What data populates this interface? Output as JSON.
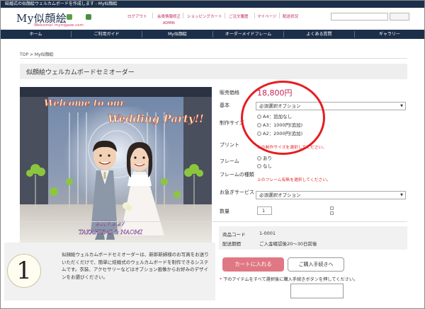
{
  "topbar": {
    "text": "結婚式の似顔絵ウェルカムボードを作成します - My似顔絵"
  },
  "header": {
    "logo_title": "My似顔絵",
    "logo_sub": "Welcome! mynigaoe.com",
    "nav": [
      "ログアウト",
      "会員情報修正",
      "ショッピングカート",
      "ご注文履歴",
      "マイページ",
      "配送状況"
    ],
    "nav_sub": "ADMIN",
    "search": {
      "value": "",
      "placeholder": ""
    }
  },
  "main_nav": [
    "ホーム",
    "ご利用ガイド",
    "My似顔絵",
    "オーダーメイドフレーム",
    "よくある質問",
    "ギャラリー"
  ],
  "breadcrumb": {
    "home": "TOP",
    "sep": ">",
    "current": "My似顔絵"
  },
  "page": {
    "title": "似顔絵ウェルカムボードセミオーダー"
  },
  "photo": {
    "line1": "Welcome to our",
    "line2": "Wedding Party!!",
    "date": "2017.2.27",
    "names": "TAKAHUMI & NAOMI"
  },
  "description": {
    "number": "1",
    "text": "似顔絵ウェルカムボードセミオーダーは、新郎新婦様のお写真をお送りいただくだけで、簡単に結婚式のウェルカムボードを制作できるシステムです。衣装、アクセサリーなどはオプション画像からお好みのデザインをお選びください。"
  },
  "options": {
    "price_label": "販売価格",
    "price": "18,800円",
    "basic_label": "基本",
    "basic_select": "必須選択オプション",
    "size_label": "制作サイズ",
    "sizes": [
      "A4：追加なし",
      "A3：1000円(追加)",
      "A2：2000円(追加)"
    ],
    "size_warning": "上の制作サイズを選択してください。",
    "print_label": "プリント",
    "frame_label": "フレーム",
    "frame_choices": [
      "あり",
      "なし"
    ],
    "frame_type_label": "フレームの種類",
    "frame_warning": "上のフレーム有無を選択してください。",
    "rush_label": "お急ぎサービス",
    "rush_select": "必須選択オプション",
    "qty_label": "数量",
    "qty_value": "1"
  },
  "info": {
    "code_label": "商品コード",
    "code_value": "1-0001",
    "period_label": "配送期間",
    "period_value": "ご入金確認後20〜30日前後"
  },
  "actions": {
    "cart": "カートに入れる",
    "proceed": "ご購入手続きへ",
    "note_mark": "*",
    "note": "下のアイテムをすべて選択後に購入手続きボタンを押してください。"
  },
  "colors": {
    "navy": "#1c2f4a",
    "accent_pink": "#c0245a",
    "cart_button": "#e07884",
    "warning_red": "#e0282a",
    "highlight_circle": "#e51e22"
  }
}
